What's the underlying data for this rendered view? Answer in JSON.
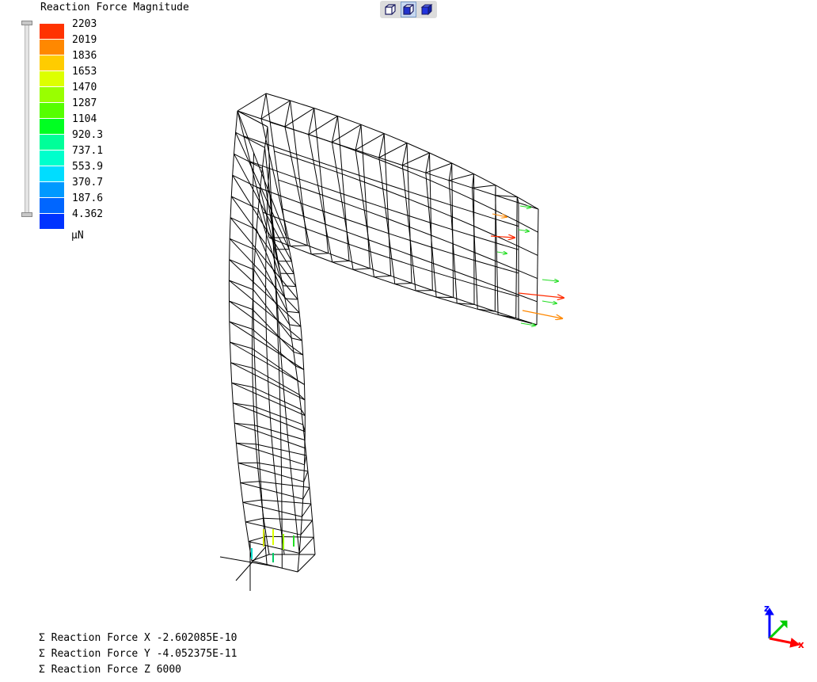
{
  "legend": {
    "title": "Reaction Force Magnitude",
    "unit": "μN",
    "values": [
      "2203",
      "2019",
      "1836",
      "1653",
      "1470",
      "1287",
      "1104",
      "920.3",
      "737.1",
      "553.9",
      "370.7",
      "187.6",
      "4.362"
    ],
    "colors": [
      "#ff3300",
      "#ff8800",
      "#ffcc00",
      "#ddff00",
      "#99ff00",
      "#55ff00",
      "#00ff22",
      "#00ff99",
      "#00ffcc",
      "#00ddff",
      "#0099ff",
      "#0066ff",
      "#0033ff"
    ]
  },
  "toolbar": {
    "buttons": [
      "wireframe-view-icon",
      "hidden-line-view-icon",
      "solid-view-icon"
    ],
    "active": 1
  },
  "summary": {
    "x": "Σ Reaction Force X -2.602085E-10",
    "y": "Σ Reaction Force Y -4.052375E-11",
    "z": "Σ Reaction Force Z 6000"
  },
  "axes": {
    "z_label": "z",
    "x_label": "x",
    "z_color": "#0000ff",
    "x_color": "#ff0000",
    "y_color": "#00cc00"
  }
}
